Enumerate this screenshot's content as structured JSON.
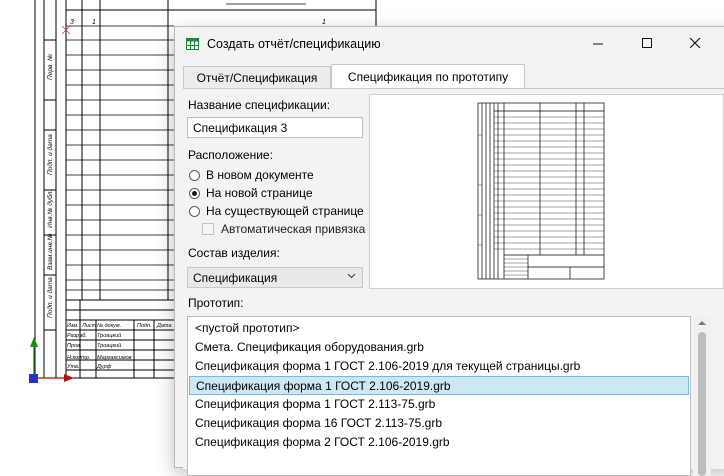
{
  "window": {
    "title": "Создать отчёт/спецификацию"
  },
  "tabs": [
    {
      "label": "Отчёт/Спецификация",
      "active": false
    },
    {
      "label": "Спецификация по прототипу",
      "active": true
    }
  ],
  "form": {
    "name_label": "Название спецификации:",
    "name_value": "Спецификация 3",
    "location_label": "Расположение:",
    "location_options": [
      {
        "label": "В новом документе",
        "selected": false
      },
      {
        "label": "На новой странице",
        "selected": true
      },
      {
        "label": "На существующей странице",
        "selected": false
      }
    ],
    "auto_bind_label": "Автоматическая привязка",
    "composition_label": "Состав изделия:",
    "composition_value": "Спецификация",
    "prototype_label": "Прототип:",
    "prototype_items": [
      "<пустой прототип>",
      "Смета. Спецификация оборудования.grb",
      "Спецификация форма 1 ГОСТ 2.106-2019 для текущей страницы.grb",
      "Спецификация форма 1 ГОСТ 2.106-2019.grb",
      "Спецификация форма 1 ГОСТ 2.113-75.grb",
      "Спецификация форма 16 ГОСТ 2.113-75.grb",
      "Спецификация форма 2 ГОСТ 2.106-2019.grb"
    ],
    "prototype_selected_index": 3
  },
  "cad": {
    "title_block_labels": [
      "Изм.",
      "Лист",
      "№ докум.",
      "Подп.",
      "Дата",
      "Разраб.",
      "Троацкий",
      "Пров.",
      "Троацкий",
      "Н.контр.",
      "Маргаксимов",
      "Утв.",
      "Дурф"
    ],
    "side_labels": [
      "Перв. №",
      "Подп. и дата",
      "Инв.№ дубл.",
      "Взам.инв.№",
      "Подп. и дата"
    ],
    "row_marks": [
      "3",
      "1",
      "1"
    ]
  },
  "colors": {
    "selection": "#cce8f6",
    "selection_border": "#7ab8db",
    "axis_y": "#1a8a1a",
    "axis_x": "#b01010",
    "origin": "#2233cc"
  }
}
